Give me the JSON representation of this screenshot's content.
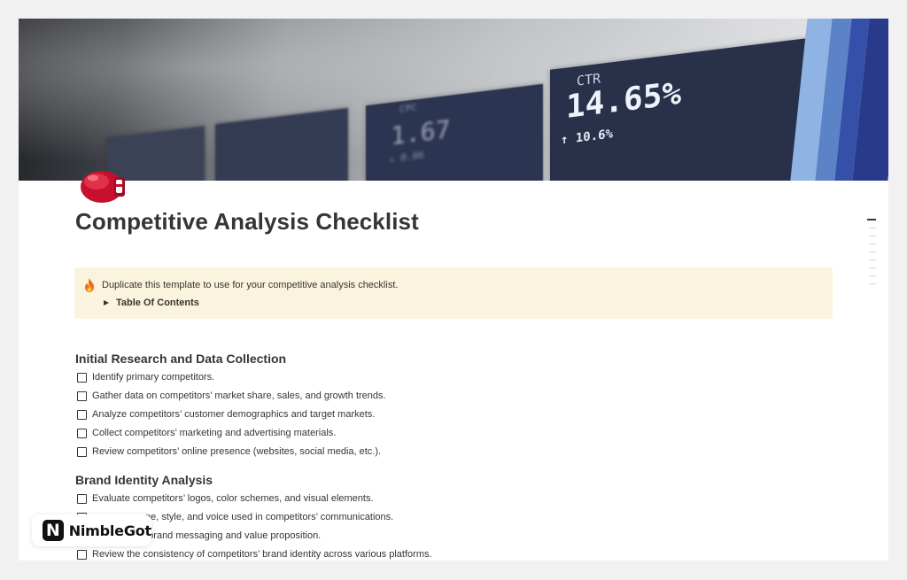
{
  "cover": {
    "metrics": [
      {
        "label": "CTR",
        "value": "14.65%",
        "delta": "↑ 10.6%"
      },
      {
        "label": "CPC",
        "value": "1.67",
        "delta": "↓ 0.06"
      }
    ]
  },
  "page": {
    "icon": "boxing-glove-icon",
    "title": "Competitive Analysis Checklist"
  },
  "callout": {
    "icon": "fire-icon",
    "text": "Duplicate this template to use for your competitive analysis checklist.",
    "toggle_label": "Table Of Contents"
  },
  "sections": [
    {
      "heading": "Initial Research and Data Collection",
      "items": [
        "Identify primary competitors.",
        "Gather data on competitors’ market share, sales, and growth trends.",
        "Analyze competitors’ customer demographics and target markets.",
        "Collect competitors’ marketing and advertising materials.",
        "Review competitors’ online presence (websites, social media, etc.)."
      ]
    },
    {
      "heading": "Brand Identity Analysis",
      "items": [
        "Evaluate competitors’ logos, color schemes, and visual elements.",
        "ne, style, and voice used in competitors’ communications.",
        "petitors’ brand messaging and value proposition.",
        "Review the consistency of competitors’ brand identity across various platforms."
      ]
    }
  ],
  "watermark": {
    "logo_letter": "N",
    "name": "NimbleGot"
  },
  "colors": {
    "callout_bg": "#faf3dd",
    "text": "#37352f"
  }
}
